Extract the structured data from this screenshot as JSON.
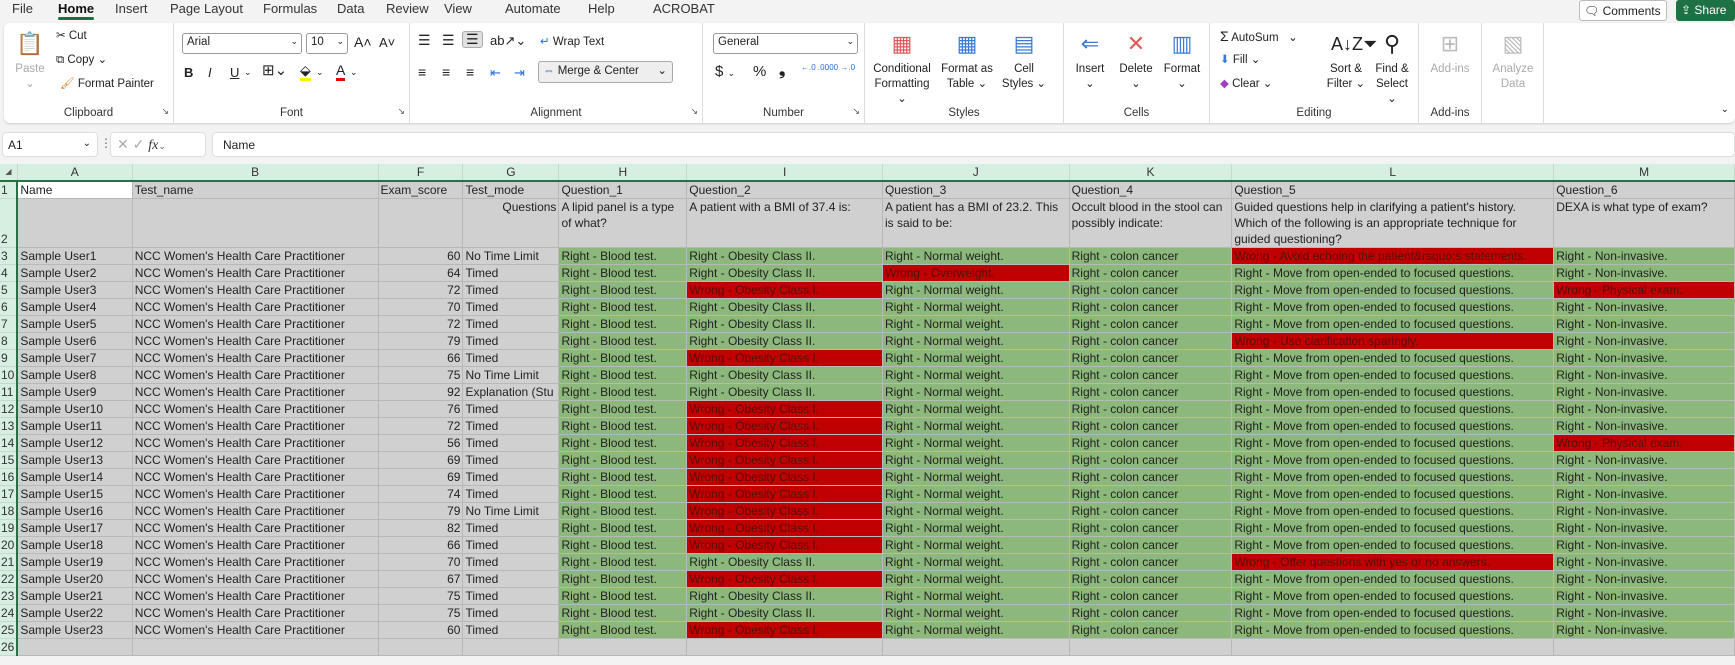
{
  "tabs": [
    "File",
    "Home",
    "Insert",
    "Page Layout",
    "Formulas",
    "Data",
    "Review",
    "View",
    "Automate",
    "Help",
    "ACROBAT"
  ],
  "active_tab": "Home",
  "top_buttons": {
    "comments": "Comments",
    "share": "Share"
  },
  "ribbon": {
    "clipboard": {
      "label": "Clipboard",
      "paste": "Paste",
      "cut": "Cut",
      "copy": "Copy",
      "format_painter": "Format Painter"
    },
    "font": {
      "label": "Font",
      "font_name": "Arial",
      "font_size": "10",
      "bold": "B",
      "italic": "I",
      "underline": "U"
    },
    "alignment": {
      "label": "Alignment",
      "wrap_text": "Wrap Text",
      "merge_center": "Merge & Center"
    },
    "number": {
      "label": "Number",
      "format": "General",
      "currency": "$",
      "percent": "%",
      "comma": "❟",
      "inc_decimal": "←.0 .00",
      "dec_decimal": ".00 →.0"
    },
    "styles": {
      "label": "Styles",
      "conditional_formatting": "Conditional Formatting",
      "format_as_table": "Format as Table",
      "cell_styles": "Cell Styles"
    },
    "cells": {
      "label": "Cells",
      "insert": "Insert",
      "delete": "Delete",
      "format": "Format"
    },
    "editing": {
      "label": "Editing",
      "autosum": "AutoSum",
      "fill": "Fill",
      "clear": "Clear",
      "sort_filter": "Sort & Filter",
      "find_select": "Find & Select"
    },
    "addins": {
      "label": "Add-ins",
      "addins_button": "Add-ins"
    },
    "analyze": {
      "analyze_data": "Analyze Data"
    }
  },
  "formula_bar": {
    "name_box": "A1",
    "fx": "fx",
    "formula": "Name"
  },
  "colors": {
    "right": "#8db87b",
    "wrong": "#c00000",
    "header_gray": "#d0d0d0",
    "accent": "#217346"
  },
  "columns": [
    "A",
    "B",
    "F",
    "G",
    "H",
    "I",
    "J",
    "K",
    "L",
    "M"
  ],
  "header_row": [
    "Name",
    "Test_name",
    "Exam_score",
    "Test_mode",
    "Question_1",
    "Question_2",
    "Question_3",
    "Question_4",
    "Question_5",
    "Question_6"
  ],
  "question_row": {
    "label": "Questions",
    "questions": [
      "A lipid panel is a type of what?",
      "A patient with a BMI of 37.4 is:",
      "A patient has a BMI of 23.2. This is said to be:",
      "Occult blood in the stool can possibly indicate:",
      "Guided questions help in clarifying a patient's history. Which of the following is an appropriate technique for guided questioning?",
      " DEXA is what type of exam?"
    ]
  },
  "rows": [
    [
      "Sample User1",
      "NCC Women's Health Care Practitioner",
      "60",
      "No Time Limit",
      "Right - Blood test.",
      "Right - Obesity Class II.",
      "Right - Normal weight.",
      "Right - colon cancer",
      "Wrong - Avoid echoing the patient&rsquo;s statements.",
      "Right - Non-invasive."
    ],
    [
      "Sample User2",
      "NCC Women's Health Care Practitioner",
      "64",
      "Timed",
      "Right - Blood test.",
      "Right - Obesity Class II.",
      "Wrong - Overweight.",
      "Right - colon cancer",
      "Right - Move from open-ended to focused questions.",
      "Right - Non-invasive."
    ],
    [
      "Sample User3",
      "NCC Women's Health Care Practitioner",
      "72",
      "Timed",
      "Right - Blood test.",
      "Wrong - Obesity Class I.",
      "Right - Normal weight.",
      "Right - colon cancer",
      "Right - Move from open-ended to focused questions.",
      "Wrong - Physical exam."
    ],
    [
      "Sample User4",
      "NCC Women's Health Care Practitioner",
      "70",
      "Timed",
      "Right - Blood test.",
      "Right - Obesity Class II.",
      "Right - Normal weight.",
      "Right - colon cancer",
      "Right - Move from open-ended to focused questions.",
      "Right - Non-invasive."
    ],
    [
      "Sample User5",
      "NCC Women's Health Care Practitioner",
      "72",
      "Timed",
      "Right - Blood test.",
      "Right - Obesity Class II.",
      "Right - Normal weight.",
      "Right - colon cancer",
      "Right - Move from open-ended to focused questions.",
      "Right - Non-invasive."
    ],
    [
      "Sample User6",
      "NCC Women's Health Care Practitioner",
      "79",
      "Timed",
      "Right - Blood test.",
      "Right - Obesity Class II.",
      "Right - Normal weight.",
      "Right - colon cancer",
      "Wrong - Use clarification sparingly.",
      "Right - Non-invasive."
    ],
    [
      "Sample User7",
      "NCC Women's Health Care Practitioner",
      "66",
      "Timed",
      "Right - Blood test.",
      "Wrong - Obesity Class I.",
      "Right - Normal weight.",
      "Right - colon cancer",
      "Right - Move from open-ended to focused questions.",
      "Right - Non-invasive."
    ],
    [
      "Sample User8",
      "NCC Women's Health Care Practitioner",
      "75",
      "No Time Limit",
      "Right - Blood test.",
      "Right - Obesity Class II.",
      "Right - Normal weight.",
      "Right - colon cancer",
      "Right - Move from open-ended to focused questions.",
      "Right - Non-invasive."
    ],
    [
      "Sample User9",
      "NCC Women's Health Care Practitioner",
      "92",
      "Explanation (Stu",
      "Right - Blood test.",
      "Right - Obesity Class II.",
      "Right - Normal weight.",
      "Right - colon cancer",
      "Right - Move from open-ended to focused questions.",
      "Right - Non-invasive."
    ],
    [
      "Sample User10",
      "NCC Women's Health Care Practitioner",
      "76",
      "Timed",
      "Right - Blood test.",
      "Wrong - Obesity Class I.",
      "Right - Normal weight.",
      "Right - colon cancer",
      "Right - Move from open-ended to focused questions.",
      "Right - Non-invasive."
    ],
    [
      "Sample User11",
      "NCC Women's Health Care Practitioner",
      "72",
      "Timed",
      "Right - Blood test.",
      "Wrong - Obesity Class I.",
      "Right - Normal weight.",
      "Right - colon cancer",
      "Right - Move from open-ended to focused questions.",
      "Right - Non-invasive."
    ],
    [
      "Sample User12",
      "NCC Women's Health Care Practitioner",
      "56",
      "Timed",
      "Right - Blood test.",
      "Wrong - Obesity Class I.",
      "Right - Normal weight.",
      "Right - colon cancer",
      "Right - Move from open-ended to focused questions.",
      "Wrong - Physical exam."
    ],
    [
      "Sample User13",
      "NCC Women's Health Care Practitioner",
      "69",
      "Timed",
      "Right - Blood test.",
      "Wrong - Obesity Class I.",
      "Right - Normal weight.",
      "Right - colon cancer",
      "Right - Move from open-ended to focused questions.",
      "Right - Non-invasive."
    ],
    [
      "Sample User14",
      "NCC Women's Health Care Practitioner",
      "69",
      "Timed",
      "Right - Blood test.",
      "Wrong - Obesity Class I.",
      "Right - Normal weight.",
      "Right - colon cancer",
      "Right - Move from open-ended to focused questions.",
      "Right - Non-invasive."
    ],
    [
      "Sample User15",
      "NCC Women's Health Care Practitioner",
      "74",
      "Timed",
      "Right - Blood test.",
      "Wrong - Obesity Class I.",
      "Right - Normal weight.",
      "Right - colon cancer",
      "Right - Move from open-ended to focused questions.",
      "Right - Non-invasive."
    ],
    [
      "Sample User16",
      "NCC Women's Health Care Practitioner",
      "79",
      "No Time Limit",
      "Right - Blood test.",
      "Wrong - Obesity Class I.",
      "Right - Normal weight.",
      "Right - colon cancer",
      "Right - Move from open-ended to focused questions.",
      "Right - Non-invasive."
    ],
    [
      "Sample User17",
      "NCC Women's Health Care Practitioner",
      "82",
      "Timed",
      "Right - Blood test.",
      "Wrong - Obesity Class I.",
      "Right - Normal weight.",
      "Right - colon cancer",
      "Right - Move from open-ended to focused questions.",
      "Right - Non-invasive."
    ],
    [
      "Sample User18",
      "NCC Women's Health Care Practitioner",
      "66",
      "Timed",
      "Right - Blood test.",
      "Wrong - Obesity Class I.",
      "Right - Normal weight.",
      "Right - colon cancer",
      "Right - Move from open-ended to focused questions.",
      "Right - Non-invasive."
    ],
    [
      "Sample User19",
      "NCC Women's Health Care Practitioner",
      "70",
      "Timed",
      "Right - Blood test.",
      "Right - Obesity Class II.",
      "Right - Normal weight.",
      "Right - colon cancer",
      "Wrong - Offer questions with  yes or no answers.",
      "Right - Non-invasive."
    ],
    [
      "Sample User20",
      "NCC Women's Health Care Practitioner",
      "67",
      "Timed",
      "Right - Blood test.",
      "Wrong - Obesity Class I.",
      "Right - Normal weight.",
      "Right - colon cancer",
      "Right - Move from open-ended to focused questions.",
      "Right - Non-invasive."
    ],
    [
      "Sample User21",
      "NCC Women's Health Care Practitioner",
      "75",
      "Timed",
      "Right - Blood test.",
      "Right - Obesity Class II.",
      "Right - Normal weight.",
      "Right - colon cancer",
      "Right - Move from open-ended to focused questions.",
      "Right - Non-invasive."
    ],
    [
      "Sample User22",
      "NCC Women's Health Care Practitioner",
      "75",
      "Timed",
      "Right - Blood test.",
      "Right - Obesity Class II.",
      "Right - Normal weight.",
      "Right - colon cancer",
      "Right - Move from open-ended to focused questions.",
      "Right - Non-invasive."
    ],
    [
      "Sample User23",
      "NCC Women's Health Care Practitioner",
      "60",
      "Timed",
      "Right - Blood test.",
      "Wrong - Obesity Class I.",
      "Right - Normal weight.",
      "Right - colon cancer",
      "Right - Move from open-ended to focused questions.",
      "Right - Non-invasive."
    ]
  ]
}
